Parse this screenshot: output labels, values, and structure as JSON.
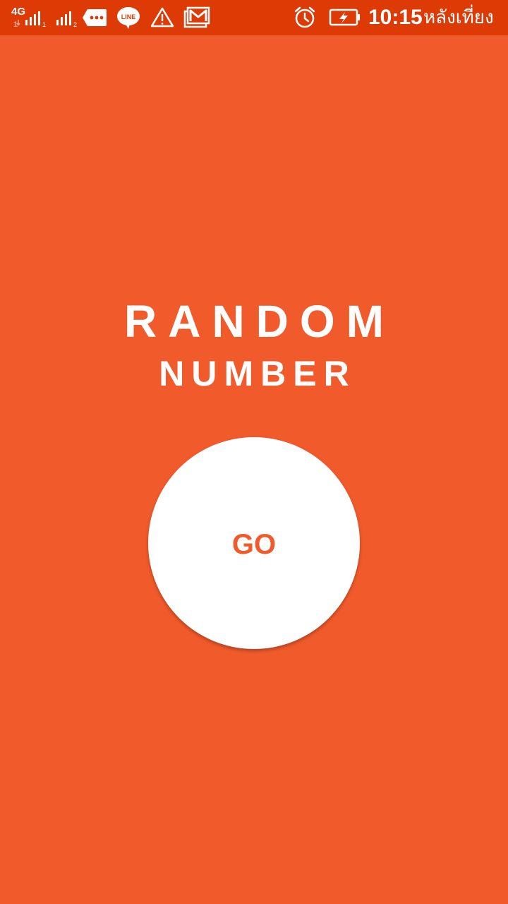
{
  "status_bar": {
    "network_label": "4G",
    "time": "10:15",
    "ampm": "หลังเที่ยง",
    "icons": [
      "signal-sim1-icon",
      "signal-sim2-icon",
      "message-icon",
      "line-app-icon",
      "warning-icon",
      "gmail-icon",
      "alarm-icon",
      "battery-charging-icon"
    ],
    "background_color": "#DE3A06"
  },
  "main": {
    "title_line1": "RANDOM",
    "title_line2": "NUMBER",
    "go_button_label": "GO",
    "background_color": "#F15A2B",
    "button_color": "#FFFFFF",
    "accent_color": "#F15A2B"
  }
}
